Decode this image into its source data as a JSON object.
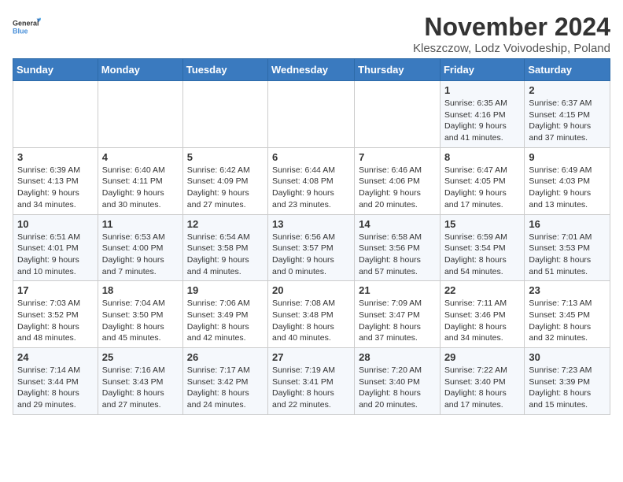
{
  "logo": {
    "line1": "General",
    "line2": "Blue"
  },
  "title": "November 2024",
  "subtitle": "Kleszczow, Lodz Voivodeship, Poland",
  "headers": [
    "Sunday",
    "Monday",
    "Tuesday",
    "Wednesday",
    "Thursday",
    "Friday",
    "Saturday"
  ],
  "weeks": [
    [
      {
        "day": "",
        "info": ""
      },
      {
        "day": "",
        "info": ""
      },
      {
        "day": "",
        "info": ""
      },
      {
        "day": "",
        "info": ""
      },
      {
        "day": "",
        "info": ""
      },
      {
        "day": "1",
        "info": "Sunrise: 6:35 AM\nSunset: 4:16 PM\nDaylight: 9 hours and 41 minutes."
      },
      {
        "day": "2",
        "info": "Sunrise: 6:37 AM\nSunset: 4:15 PM\nDaylight: 9 hours and 37 minutes."
      }
    ],
    [
      {
        "day": "3",
        "info": "Sunrise: 6:39 AM\nSunset: 4:13 PM\nDaylight: 9 hours and 34 minutes."
      },
      {
        "day": "4",
        "info": "Sunrise: 6:40 AM\nSunset: 4:11 PM\nDaylight: 9 hours and 30 minutes."
      },
      {
        "day": "5",
        "info": "Sunrise: 6:42 AM\nSunset: 4:09 PM\nDaylight: 9 hours and 27 minutes."
      },
      {
        "day": "6",
        "info": "Sunrise: 6:44 AM\nSunset: 4:08 PM\nDaylight: 9 hours and 23 minutes."
      },
      {
        "day": "7",
        "info": "Sunrise: 6:46 AM\nSunset: 4:06 PM\nDaylight: 9 hours and 20 minutes."
      },
      {
        "day": "8",
        "info": "Sunrise: 6:47 AM\nSunset: 4:05 PM\nDaylight: 9 hours and 17 minutes."
      },
      {
        "day": "9",
        "info": "Sunrise: 6:49 AM\nSunset: 4:03 PM\nDaylight: 9 hours and 13 minutes."
      }
    ],
    [
      {
        "day": "10",
        "info": "Sunrise: 6:51 AM\nSunset: 4:01 PM\nDaylight: 9 hours and 10 minutes."
      },
      {
        "day": "11",
        "info": "Sunrise: 6:53 AM\nSunset: 4:00 PM\nDaylight: 9 hours and 7 minutes."
      },
      {
        "day": "12",
        "info": "Sunrise: 6:54 AM\nSunset: 3:58 PM\nDaylight: 9 hours and 4 minutes."
      },
      {
        "day": "13",
        "info": "Sunrise: 6:56 AM\nSunset: 3:57 PM\nDaylight: 9 hours and 0 minutes."
      },
      {
        "day": "14",
        "info": "Sunrise: 6:58 AM\nSunset: 3:56 PM\nDaylight: 8 hours and 57 minutes."
      },
      {
        "day": "15",
        "info": "Sunrise: 6:59 AM\nSunset: 3:54 PM\nDaylight: 8 hours and 54 minutes."
      },
      {
        "day": "16",
        "info": "Sunrise: 7:01 AM\nSunset: 3:53 PM\nDaylight: 8 hours and 51 minutes."
      }
    ],
    [
      {
        "day": "17",
        "info": "Sunrise: 7:03 AM\nSunset: 3:52 PM\nDaylight: 8 hours and 48 minutes."
      },
      {
        "day": "18",
        "info": "Sunrise: 7:04 AM\nSunset: 3:50 PM\nDaylight: 8 hours and 45 minutes."
      },
      {
        "day": "19",
        "info": "Sunrise: 7:06 AM\nSunset: 3:49 PM\nDaylight: 8 hours and 42 minutes."
      },
      {
        "day": "20",
        "info": "Sunrise: 7:08 AM\nSunset: 3:48 PM\nDaylight: 8 hours and 40 minutes."
      },
      {
        "day": "21",
        "info": "Sunrise: 7:09 AM\nSunset: 3:47 PM\nDaylight: 8 hours and 37 minutes."
      },
      {
        "day": "22",
        "info": "Sunrise: 7:11 AM\nSunset: 3:46 PM\nDaylight: 8 hours and 34 minutes."
      },
      {
        "day": "23",
        "info": "Sunrise: 7:13 AM\nSunset: 3:45 PM\nDaylight: 8 hours and 32 minutes."
      }
    ],
    [
      {
        "day": "24",
        "info": "Sunrise: 7:14 AM\nSunset: 3:44 PM\nDaylight: 8 hours and 29 minutes."
      },
      {
        "day": "25",
        "info": "Sunrise: 7:16 AM\nSunset: 3:43 PM\nDaylight: 8 hours and 27 minutes."
      },
      {
        "day": "26",
        "info": "Sunrise: 7:17 AM\nSunset: 3:42 PM\nDaylight: 8 hours and 24 minutes."
      },
      {
        "day": "27",
        "info": "Sunrise: 7:19 AM\nSunset: 3:41 PM\nDaylight: 8 hours and 22 minutes."
      },
      {
        "day": "28",
        "info": "Sunrise: 7:20 AM\nSunset: 3:40 PM\nDaylight: 8 hours and 20 minutes."
      },
      {
        "day": "29",
        "info": "Sunrise: 7:22 AM\nSunset: 3:40 PM\nDaylight: 8 hours and 17 minutes."
      },
      {
        "day": "30",
        "info": "Sunrise: 7:23 AM\nSunset: 3:39 PM\nDaylight: 8 hours and 15 minutes."
      }
    ]
  ]
}
